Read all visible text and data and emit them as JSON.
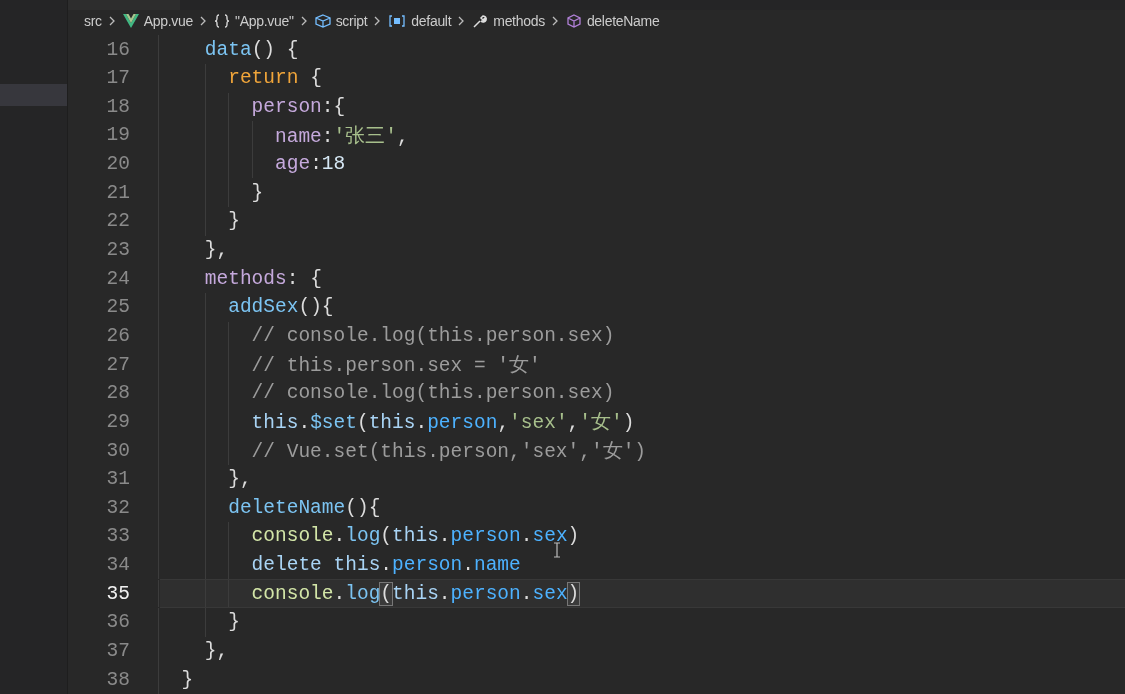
{
  "breadcrumbs": [
    {
      "label": "src",
      "kind": "folder"
    },
    {
      "label": "App.vue",
      "kind": "file"
    },
    {
      "label": "\"App.vue\"",
      "kind": "object"
    },
    {
      "label": "script",
      "kind": "module"
    },
    {
      "label": "default",
      "kind": "variable"
    },
    {
      "label": "methods",
      "kind": "property"
    },
    {
      "label": "deleteName",
      "kind": "method"
    }
  ],
  "lines": [
    {
      "number": "16",
      "current": false,
      "tokens": [
        {
          "text": "    data",
          "kind": "fn"
        },
        {
          "text": "() {",
          "kind": "punct"
        }
      ]
    },
    {
      "number": "17",
      "current": false,
      "tokens": [
        {
          "text": "      return",
          "kind": "keyword"
        },
        {
          "text": " {",
          "kind": "punct"
        }
      ]
    },
    {
      "number": "18",
      "current": false,
      "tokens": [
        {
          "text": "        person",
          "kind": "prop"
        },
        {
          "text": ":{",
          "kind": "punct"
        }
      ]
    },
    {
      "number": "19",
      "current": false,
      "tokens": [
        {
          "text": "          name",
          "kind": "prop"
        },
        {
          "text": ":",
          "kind": "punct"
        },
        {
          "text": "'张三'",
          "kind": "string"
        },
        {
          "text": ",",
          "kind": "punct"
        }
      ]
    },
    {
      "number": "20",
      "current": false,
      "tokens": [
        {
          "text": "          age",
          "kind": "prop"
        },
        {
          "text": ":",
          "kind": "punct"
        },
        {
          "text": "18",
          "kind": "number"
        }
      ]
    },
    {
      "number": "21",
      "current": false,
      "tokens": [
        {
          "text": "        }",
          "kind": "punct"
        }
      ]
    },
    {
      "number": "22",
      "current": false,
      "tokens": [
        {
          "text": "      }",
          "kind": "punct"
        }
      ]
    },
    {
      "number": "23",
      "current": false,
      "tokens": [
        {
          "text": "    },",
          "kind": "punct"
        }
      ]
    },
    {
      "number": "24",
      "current": false,
      "tokens": [
        {
          "text": "    methods",
          "kind": "prop"
        },
        {
          "text": ": {",
          "kind": "punct"
        }
      ]
    },
    {
      "number": "25",
      "current": false,
      "tokens": [
        {
          "text": "      addSex",
          "kind": "fn"
        },
        {
          "text": "(){",
          "kind": "punct"
        }
      ]
    },
    {
      "number": "26",
      "current": false,
      "tokens": [
        {
          "text": "        // console.log(this.person.sex)",
          "kind": "comment"
        }
      ]
    },
    {
      "number": "27",
      "current": false,
      "tokens": [
        {
          "text": "        // this.person.sex = '女'",
          "kind": "comment"
        }
      ]
    },
    {
      "number": "28",
      "current": false,
      "tokens": [
        {
          "text": "        // console.log(this.person.sex)",
          "kind": "comment"
        }
      ]
    },
    {
      "number": "29",
      "current": false,
      "tokens": [
        {
          "text": "        this",
          "kind": "this"
        },
        {
          "text": ".",
          "kind": "punct"
        },
        {
          "text": "$set",
          "kind": "fn"
        },
        {
          "text": "(",
          "kind": "punct"
        },
        {
          "text": "this",
          "kind": "this"
        },
        {
          "text": ".",
          "kind": "punct"
        },
        {
          "text": "person",
          "kind": "member"
        },
        {
          "text": ",",
          "kind": "punct"
        },
        {
          "text": "'sex'",
          "kind": "string"
        },
        {
          "text": ",",
          "kind": "punct"
        },
        {
          "text": "'女'",
          "kind": "string"
        },
        {
          "text": ")",
          "kind": "punct"
        }
      ]
    },
    {
      "number": "30",
      "current": false,
      "tokens": [
        {
          "text": "        // Vue.set(this.person,'sex','女')",
          "kind": "comment"
        }
      ]
    },
    {
      "number": "31",
      "current": false,
      "tokens": [
        {
          "text": "      },",
          "kind": "punct"
        }
      ]
    },
    {
      "number": "32",
      "current": false,
      "tokens": [
        {
          "text": "      deleteName",
          "kind": "fn"
        },
        {
          "text": "(){",
          "kind": "punct"
        }
      ]
    },
    {
      "number": "33",
      "current": false,
      "tokens": [
        {
          "text": "        console",
          "kind": "var"
        },
        {
          "text": ".",
          "kind": "punct"
        },
        {
          "text": "log",
          "kind": "fn"
        },
        {
          "text": "(",
          "kind": "punct"
        },
        {
          "text": "this",
          "kind": "this"
        },
        {
          "text": ".",
          "kind": "punct"
        },
        {
          "text": "person",
          "kind": "member"
        },
        {
          "text": ".",
          "kind": "punct"
        },
        {
          "text": "sex",
          "kind": "member"
        },
        {
          "text": ")",
          "kind": "punct"
        }
      ]
    },
    {
      "number": "34",
      "current": false,
      "tokens": [
        {
          "text": "        delete this",
          "kind": "this"
        },
        {
          "text": ".",
          "kind": "punct"
        },
        {
          "text": "person",
          "kind": "member"
        },
        {
          "text": ".",
          "kind": "punct"
        },
        {
          "text": "name",
          "kind": "member"
        }
      ]
    },
    {
      "number": "35",
      "current": true,
      "tokens": [
        {
          "text": "        console",
          "kind": "var"
        },
        {
          "text": ".",
          "kind": "punct"
        },
        {
          "text": "log",
          "kind": "fn"
        },
        {
          "text": "(",
          "kind": "bracket"
        },
        {
          "text": "this",
          "kind": "this"
        },
        {
          "text": ".",
          "kind": "punct"
        },
        {
          "text": "person",
          "kind": "member"
        },
        {
          "text": ".",
          "kind": "punct"
        },
        {
          "text": "sex",
          "kind": "member"
        },
        {
          "text": ")",
          "kind": "bracket"
        }
      ]
    },
    {
      "number": "36",
      "current": false,
      "tokens": [
        {
          "text": "      }",
          "kind": "punct"
        }
      ]
    },
    {
      "number": "37",
      "current": false,
      "tokens": [
        {
          "text": "    },",
          "kind": "punct"
        }
      ]
    },
    {
      "number": "38",
      "current": false,
      "tokens": [
        {
          "text": "  }",
          "kind": "punct"
        }
      ]
    }
  ]
}
